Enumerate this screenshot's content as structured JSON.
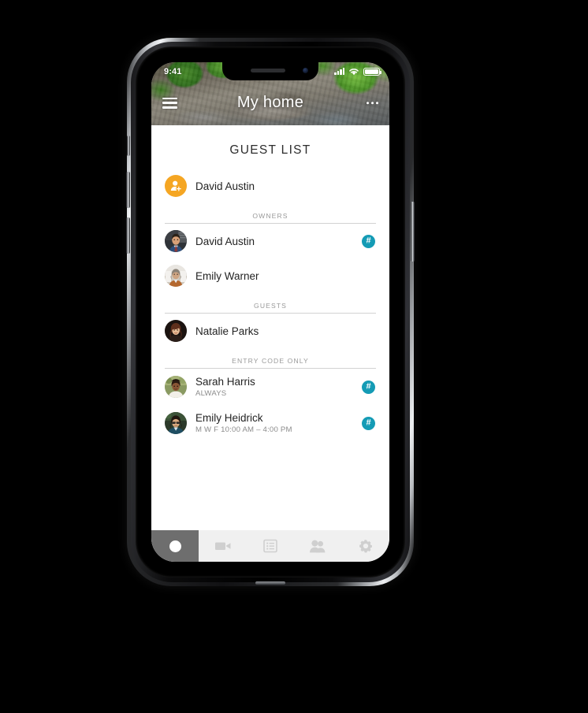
{
  "status_bar": {
    "time": "9:41",
    "signal_icon": "cellular-signal-icon",
    "wifi_icon": "wifi-icon",
    "battery_icon": "battery-full-icon"
  },
  "nav": {
    "title": "My home",
    "menu_icon": "hamburger-menu-icon",
    "overflow_icon": "more-options-icon"
  },
  "page": {
    "title": "GUEST LIST"
  },
  "add_row": {
    "label": "David Austin",
    "icon": "add-person-icon",
    "icon_color": "#f5a623"
  },
  "badge": {
    "glyph": "#",
    "name": "entry-code-keypad-icon",
    "color": "#149bb5"
  },
  "sections": [
    {
      "label": "OWNERS",
      "people": [
        {
          "name": "David Austin",
          "sub": "",
          "has_code": true
        },
        {
          "name": "Emily Warner",
          "sub": "",
          "has_code": false
        }
      ]
    },
    {
      "label": "GUESTS",
      "people": [
        {
          "name": "Natalie Parks",
          "sub": "",
          "has_code": false
        }
      ]
    },
    {
      "label": "ENTRY CODE ONLY",
      "people": [
        {
          "name": "Sarah Harris",
          "sub": "ALWAYS",
          "has_code": true
        },
        {
          "name": "Emily Heidrick",
          "sub": "M W F 10:00 AM – 4:00 PM",
          "has_code": true
        }
      ]
    }
  ],
  "tabbar": {
    "items": [
      {
        "icon": "record-circle-icon",
        "active": true
      },
      {
        "icon": "video-camera-icon",
        "active": false
      },
      {
        "icon": "list-icon",
        "active": false
      },
      {
        "icon": "people-icon",
        "active": false
      },
      {
        "icon": "gear-icon",
        "active": false
      }
    ]
  }
}
